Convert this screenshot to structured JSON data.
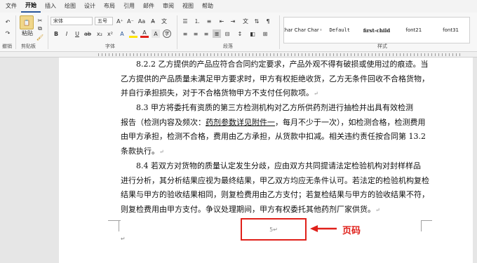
{
  "ribbon_tabs": [
    "文件",
    "开始",
    "插入",
    "绘图",
    "设计",
    "布局",
    "引用",
    "邮件",
    "审阅",
    "视图",
    "帮助"
  ],
  "active_tab": "开始",
  "clipboard": {
    "paste_label": "粘贴",
    "group_label": "剪贴板"
  },
  "undo_group_label": "撤销",
  "font": {
    "family": "宋体",
    "size": "五号",
    "group_label": "字体",
    "buttons": [
      "B",
      "I",
      "U",
      "A"
    ]
  },
  "paragraph": {
    "group_label": "段落"
  },
  "styles": {
    "group_label": "样式",
    "items": [
      "Char Char Char C",
      "Default",
      "first-child",
      "font21",
      "font31"
    ]
  },
  "document": {
    "lines": [
      {
        "text": "8.2.2 乙方提供的产品应符合合同约定要求，产品外观不得有破损或使用过的痕迹。当",
        "indent": true,
        "mark": false
      },
      {
        "text": "乙方提供的产品质量未满足甲方要求时，甲方有权拒绝收货，乙方无条件回收不合格货物，",
        "indent": false,
        "mark": false
      },
      {
        "text": "并自行承担损失，对于不合格货物甲方不支付任何款项。",
        "indent": false,
        "mark": true
      },
      {
        "text": "8.3  甲方将委托有资质的第三方检测机构对乙方所供药剂进行抽检并出具有效检测",
        "indent": true,
        "mark": false
      },
      {
        "pre": "报告（检测内容及频次：",
        "underlined": "药剂参数详见附件一",
        "post": "，每月不少于一次），如检测合格，检测费用",
        "indent": false,
        "mark": false
      },
      {
        "text": "由甲方承担，检测不合格，费用由乙方承担，从货款中扣减。相关违约责任按合同第 13.2",
        "indent": false,
        "mark": false
      },
      {
        "text": "条款执行。",
        "indent": false,
        "mark": true
      },
      {
        "text": "8.4  若双方对货物的质量认定发生分歧，应由双方共同提请法定检验机构对封样样品",
        "indent": true,
        "mark": false
      },
      {
        "text": "进行分析，其分析结果应视为最终结果，甲乙双方均应无条件认可。若法定的检验机构复检",
        "indent": false,
        "mark": false
      },
      {
        "text": "结果与甲方的验收结果相同，则复检费用由乙方支付；若复检结果与甲方的验收结果不符，",
        "indent": false,
        "mark": false
      },
      {
        "text": "则复检费用由甲方支付。争议处理期间，甲方有权委托其他药剂厂家供货。",
        "indent": false,
        "mark": true
      }
    ],
    "paragraph_mark": "↵",
    "page_number": "5",
    "annotation_label": "页码"
  },
  "colors": {
    "accent": "#2b579a",
    "annotation": "#e0201a"
  }
}
